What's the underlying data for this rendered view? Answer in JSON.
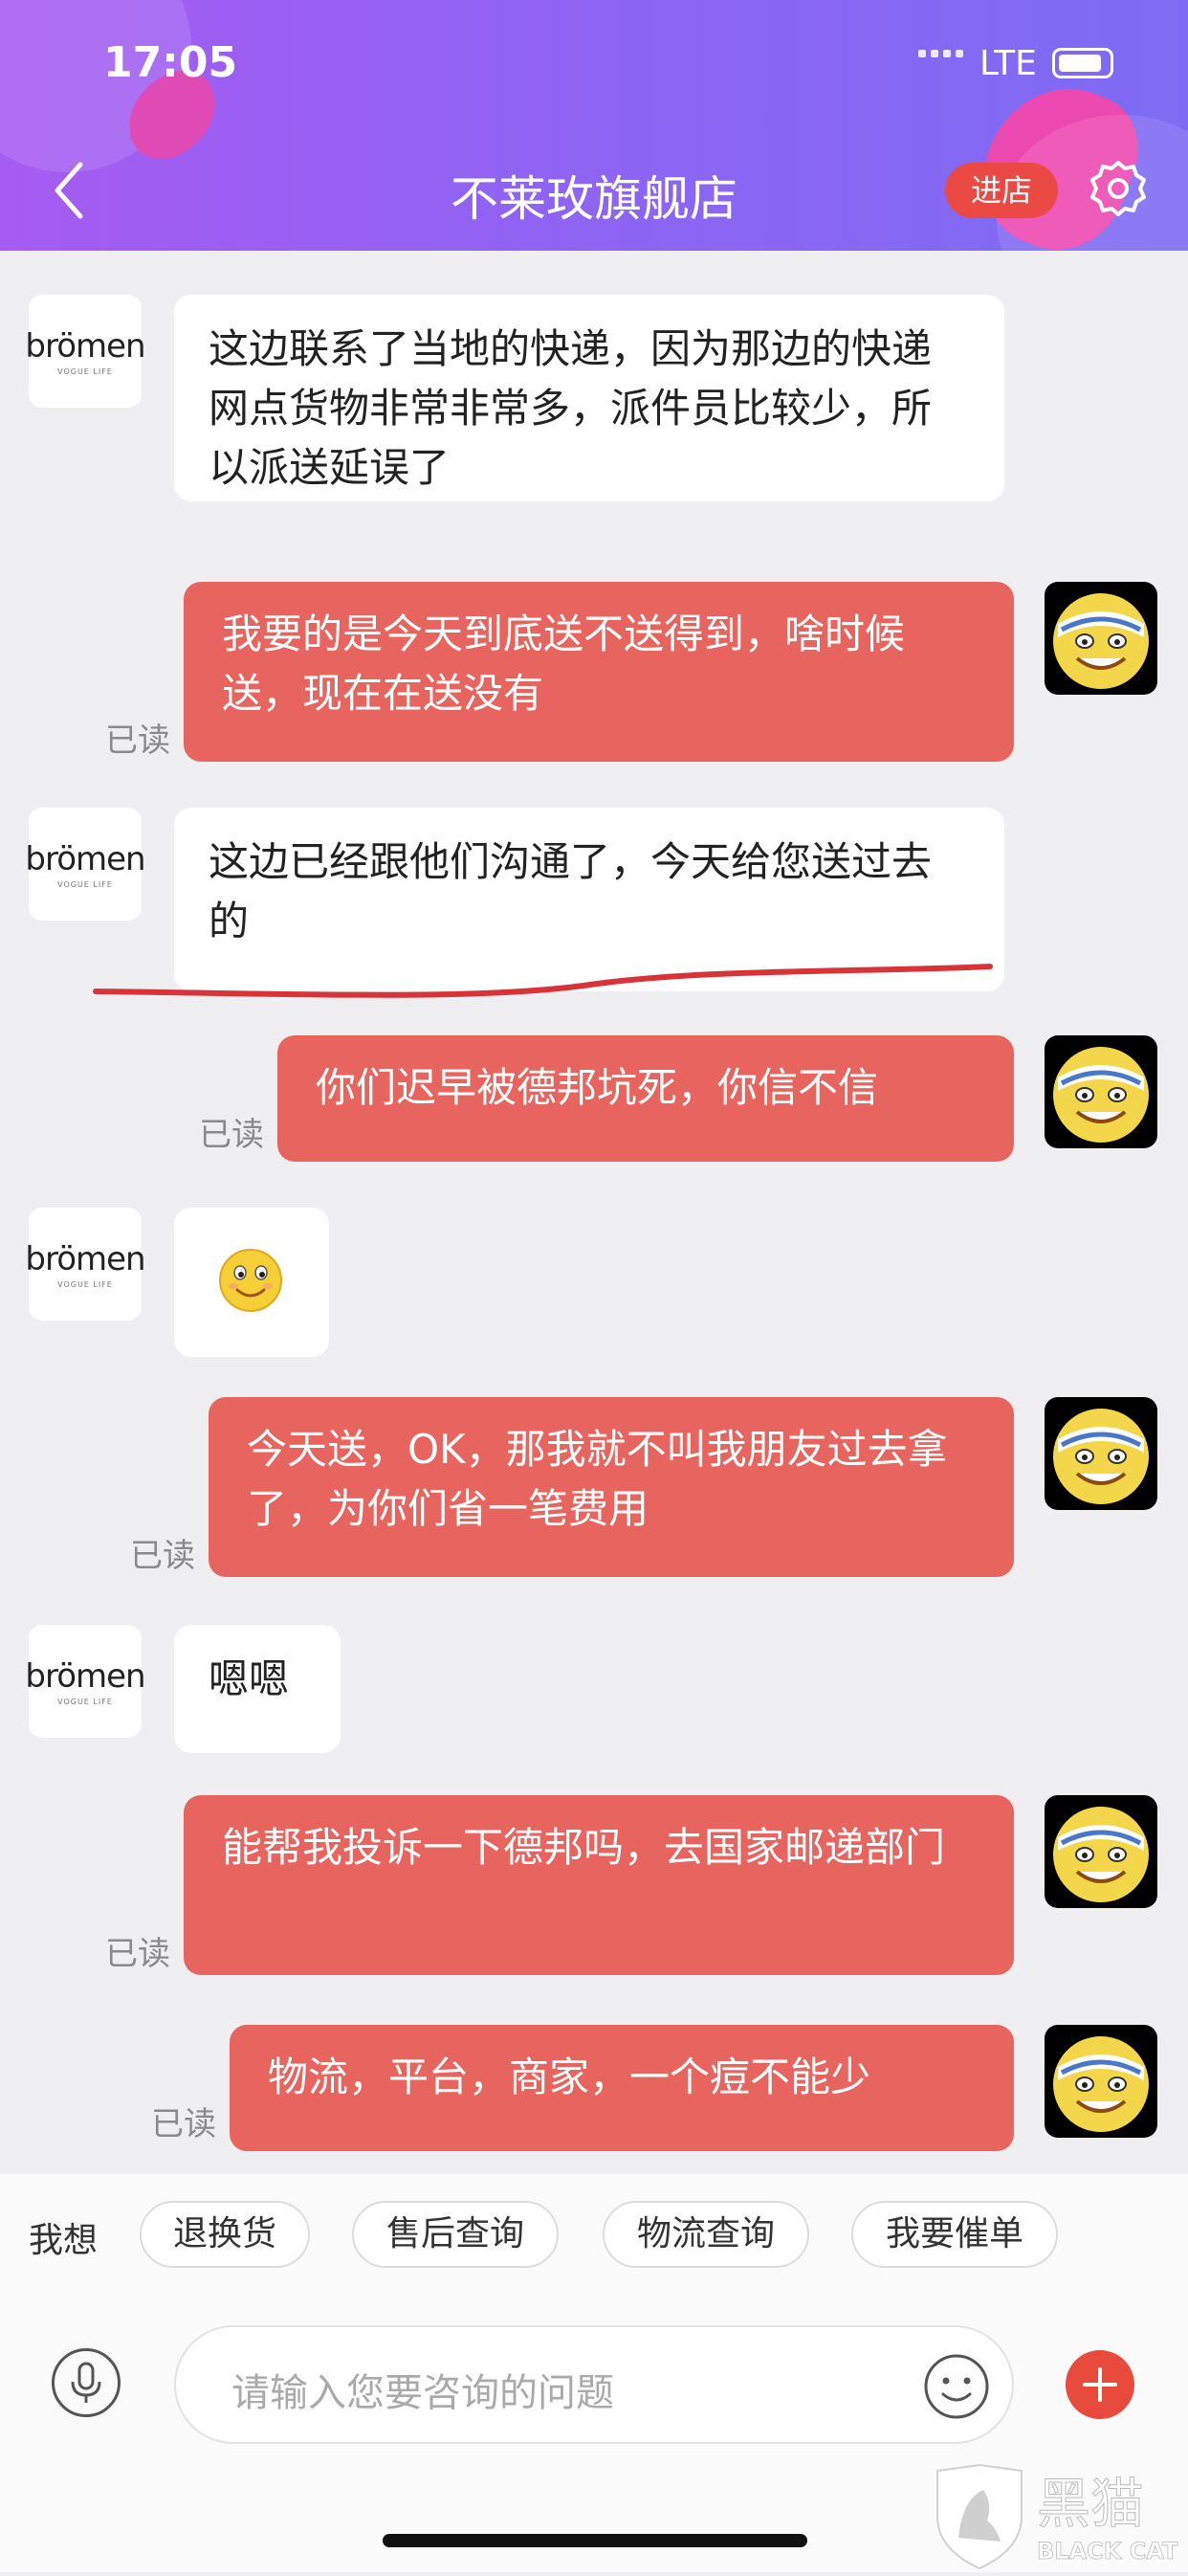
{
  "status": {
    "time": "17:05",
    "network": "LTE"
  },
  "header": {
    "title": "不莱玫旗舰店",
    "enter_label": "进店"
  },
  "shop": {
    "logo_text": "brömen",
    "logo_sub": "VOGUE LIFE"
  },
  "messages": [
    {
      "side": "left",
      "text": "这边联系了当地的快递，因为那边的快递网点货物非常非常多，派件员比较少，所以派送延误了"
    },
    {
      "side": "right",
      "text": "我要的是今天到底送不送得到，啥时候送，现在在送没有",
      "read": "已读"
    },
    {
      "side": "left",
      "text": "这边已经跟他们沟通了，今天给您送过去的"
    },
    {
      "side": "right",
      "text": "你们迟早被德邦坑死，你信不信",
      "read": "已读"
    },
    {
      "side": "left",
      "text": ""
    },
    {
      "side": "right",
      "text": "今天送，OK，那我就不叫我朋友过去拿了，为你们省一笔费用",
      "read": "已读"
    },
    {
      "side": "left",
      "text": "嗯嗯"
    },
    {
      "side": "right",
      "text": "能帮我投诉一下德邦吗，去国家邮递部门",
      "read": "已读"
    },
    {
      "side": "right",
      "text": "物流，平台，商家，一个痘不能少",
      "read": "已读"
    }
  ],
  "quick": {
    "label": "我想",
    "chips": [
      "退换货",
      "售后查询",
      "物流查询",
      "我要催单"
    ]
  },
  "input": {
    "placeholder": "请输入您要咨询的问题"
  },
  "watermark": {
    "text_cn": "黑猫",
    "text_en": "BLACK CAT"
  },
  "colors": {
    "header_gradient_start": "#a65bf2",
    "header_gradient_end": "#7d6cf3",
    "user_bubble": "#e8655f",
    "annotation_line": "#d9333a",
    "accent_red": "#ea4a43"
  }
}
